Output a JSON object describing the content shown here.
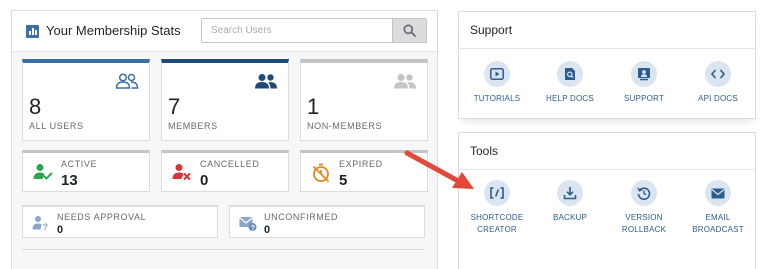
{
  "stats": {
    "title": "Your Membership Stats",
    "search_placeholder": "Search Users",
    "cards": [
      {
        "value": "8",
        "label": "ALL USERS",
        "accent": "#3b6fa8"
      },
      {
        "value": "7",
        "label": "MEMBERS",
        "accent": "#1d4a7a"
      },
      {
        "value": "1",
        "label": "NON-MEMBERS",
        "accent": "#c3c4c7"
      }
    ],
    "status": [
      {
        "label": "ACTIVE",
        "value": "13",
        "icon": "user-check-icon",
        "color": "#2ea44f"
      },
      {
        "label": "CANCELLED",
        "value": "0",
        "icon": "user-x-icon",
        "color": "#d63638"
      },
      {
        "label": "EXPIRED",
        "value": "5",
        "icon": "timer-off-icon",
        "color": "#e08a1e"
      }
    ],
    "pending": [
      {
        "label": "NEEDS APPROVAL",
        "value": "0",
        "icon": "user-question-icon"
      },
      {
        "label": "UNCONFIRMED",
        "value": "0",
        "icon": "mail-question-icon"
      }
    ]
  },
  "support": {
    "title": "Support",
    "items": [
      {
        "label": "TUTORIALS",
        "icon": "video-icon"
      },
      {
        "label": "HELP DOCS",
        "icon": "search-doc-icon"
      },
      {
        "label": "SUPPORT",
        "icon": "support-contact-icon"
      },
      {
        "label": "API DOCS",
        "icon": "code-icon"
      }
    ]
  },
  "tools": {
    "title": "Tools",
    "items": [
      {
        "label_line1": "SHORTCODE",
        "label_line2": "CREATOR",
        "icon": "shortcode-icon"
      },
      {
        "label_line1": "BACKUP",
        "label_line2": "",
        "icon": "download-tray-icon"
      },
      {
        "label_line1": "VERSION",
        "label_line2": "ROLLBACK",
        "icon": "rollback-icon"
      },
      {
        "label_line1": "EMAIL",
        "label_line2": "BROADCAST",
        "icon": "email-icon"
      }
    ]
  },
  "colors": {
    "accent_blue": "#3b6fa8",
    "link_blue": "#2c5d91",
    "arrow_red": "#e2493a"
  }
}
